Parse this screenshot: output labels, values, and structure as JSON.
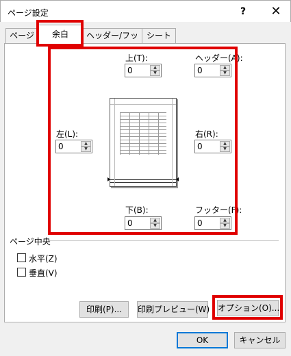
{
  "dialog": {
    "title": "ページ設定",
    "help": "?",
    "close": "✕"
  },
  "tabs": [
    "ページ",
    "余白",
    "ヘッダー/フッター",
    "シート"
  ],
  "margins": {
    "top": {
      "label": "上(T):",
      "value": "0"
    },
    "header": {
      "label": "ヘッダー(A):",
      "value": "0"
    },
    "left": {
      "label": "左(L):",
      "value": "0"
    },
    "right": {
      "label": "右(R):",
      "value": "0"
    },
    "bottom": {
      "label": "下(B):",
      "value": "0"
    },
    "footer": {
      "label": "フッター(F):",
      "value": "0"
    }
  },
  "center": {
    "group_label": "ページ中央",
    "horizontal": "水平(Z)",
    "vertical": "垂直(V)"
  },
  "buttons": {
    "print": "印刷(P)...",
    "preview": "印刷プレビュー(W)",
    "options": "オプション(O)...",
    "ok": "OK",
    "cancel": "キャンセル"
  },
  "colors": {
    "highlight": "#e00000",
    "primary_border": "#0078d7"
  }
}
